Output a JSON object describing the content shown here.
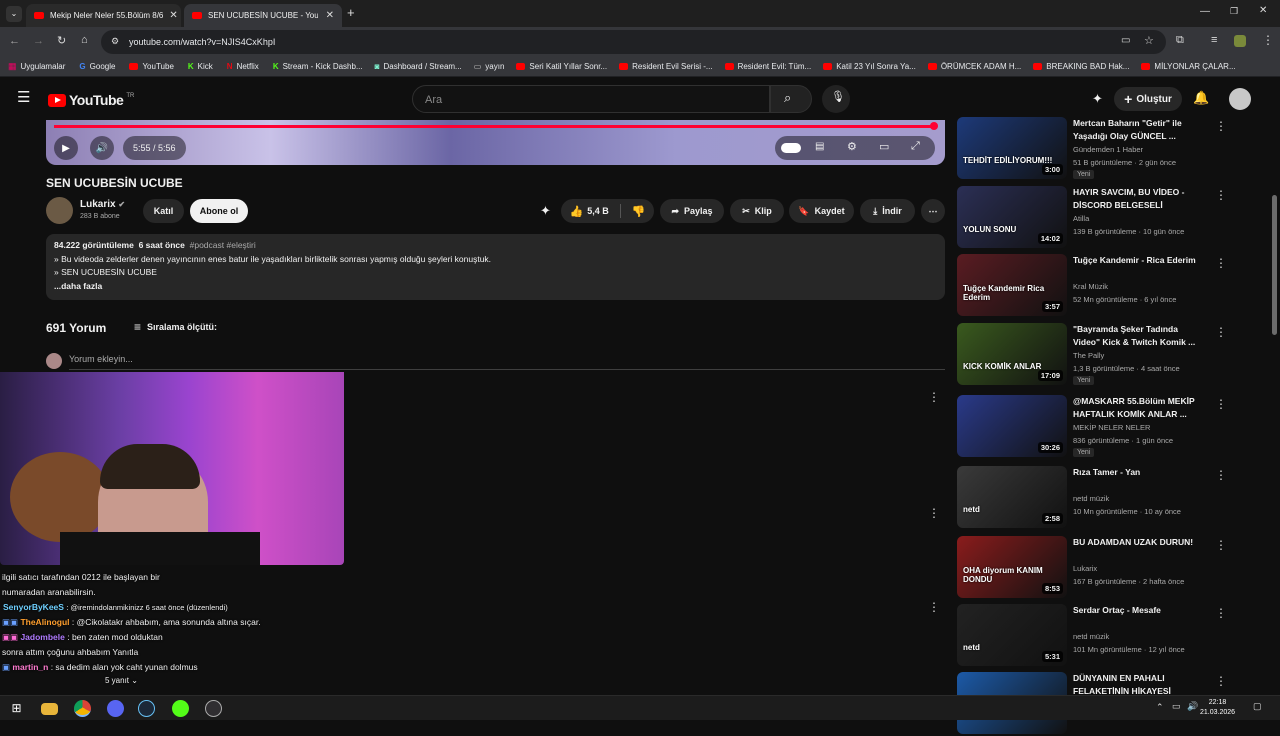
{
  "browser": {
    "tabs": [
      {
        "title": "Mekip Neler Neler 55.Bölüm 8/6"
      },
      {
        "title": "SEN UCUBESİN UCUBE - YouTube"
      }
    ],
    "url": "youtube.com/watch?v=NJIS4CxKhpI",
    "bookmarks": [
      "Uygulamalar",
      "Google",
      "YouTube",
      "Kick",
      "Netflix",
      "Stream - Kick Dashb...",
      "Dashboard / Stream...",
      "yayın",
      "Seri Katil Yıllar Sonr...",
      "Resident Evil Serisi -...",
      "Resident Evil: Tüm...",
      "Katil 23 Yıl Sonra Ya...",
      "ÖRÜMCEK ADAM H...",
      "BREAKING BAD Hak...",
      "MİLYONLAR ÇALAR..."
    ]
  },
  "header": {
    "logo": "YouTube",
    "logo_sup": "TR",
    "search_placeholder": "Ara",
    "create_label": "Oluştur"
  },
  "player": {
    "time": "5:55 / 5:56",
    "progress": 0.997
  },
  "video": {
    "title": "SEN UCUBESİN UCUBE",
    "channel": "Lukarix",
    "subscribers": "283 B abone",
    "join_label": "Katıl",
    "subscribe_label": "Abone ol",
    "likes": "5,4 B",
    "share_label": "Paylaş",
    "clip_label": "Klip",
    "save_label": "Kaydet",
    "download_label": "İndir"
  },
  "description": {
    "views": "84.222 görüntüleme",
    "age": "6 saat önce",
    "tags": "#podcast #eleştiri",
    "line1": "» Bu videoda zelderler denen yayıncının enes batur ile yaşadıkları birliktelik sonrası yapmış olduğu şeyleri konuştuk.",
    "line2": "» SEN UCUBESİN UCUBE",
    "more": "...daha fazla"
  },
  "comments": {
    "count": "691 Yorum",
    "sort_label": "Sıralama ölçütü:",
    "add_placeholder": "Yorum ekleyin..."
  },
  "chat": [
    {
      "user": "",
      "text": "ilgili satıcı tarafından 0212 ile başlayan bir"
    },
    {
      "user": "",
      "text": "numaradan aranabilirsin."
    },
    {
      "user": "SenyorByKeeS",
      "text": ": @iremindolanmikinizz 6 saat önce (düzenlendi)"
    },
    {
      "user": "TheAlinogul",
      "text": ": @Cikolatakr ahbabım, ama sonunda altına sıçar."
    },
    {
      "user": "Jadombele",
      "text": ": ben zaten mod olduktan"
    },
    {
      "user": "",
      "text": "sonra attım çoğunu ahbabım     Yanıtla"
    },
    {
      "user": "martin_n",
      "text": ": sa dedim alan yok caht yunan dolmus"
    },
    {
      "user": "",
      "text": "5 yanıt"
    }
  ],
  "sidebar": [
    {
      "title": "Mertcan Baharın \"Getir\" ile Yaşadığı Olay GÜNCEL ...",
      "channel": "Gündemden 1 Haber",
      "meta": "51 B görüntüleme · 2 gün önce",
      "duration": "3:00",
      "new": "Yeni",
      "thumb_text": "TEHDİT EDİLİYORUM!!!",
      "color": "#1d3a7a"
    },
    {
      "title": "HAYIR SAVCIM, BU VİDEO - DİSCORD BELGESELİ",
      "channel": "Atilla",
      "meta": "139 B görüntüleme · 10 gün önce",
      "duration": "14:02",
      "new": "",
      "thumb_text": "YOLUN SONU",
      "color": "#2b2f55"
    },
    {
      "title": "Tuğçe Kandemir - Rica Ederim",
      "channel": "Kral Müzik",
      "meta": "52 Mn görüntüleme · 6 yıl önce",
      "duration": "3:57",
      "new": "",
      "thumb_text": "Tuğçe Kandemir Rica Ederim",
      "color": "#5a1c22"
    },
    {
      "title": "\"Bayramda Şeker Tadında Video\" Kick & Twitch Komik ...",
      "channel": "The Pally",
      "meta": "1,3 B görüntüleme · 4 saat önce",
      "duration": "17:09",
      "new": "Yeni",
      "thumb_text": "KICK KOMİK ANLAR",
      "color": "#3a5a1e"
    },
    {
      "title": "@MASKARR 55.Bölüm MEKİP HAFTALIK KOMİK ANLAR ...",
      "channel": "MEKİP NELER NELER",
      "meta": "836 görüntüleme · 1 gün önce",
      "duration": "30:26",
      "new": "Yeni",
      "thumb_text": "",
      "color": "#2a3a8a"
    },
    {
      "title": "Rıza Tamer - Yan",
      "channel": "netd müzik",
      "meta": "10 Mn görüntüleme · 10 ay önce",
      "duration": "2:58",
      "new": "",
      "thumb_text": "netd",
      "color": "#3a3a3a"
    },
    {
      "title": "BU ADAMDAN UZAK DURUN!",
      "channel": "Lukarix",
      "meta": "167 B görüntüleme · 2 hafta önce",
      "duration": "8:53",
      "new": "",
      "thumb_text": "OHA diyorum KANIM DONDU",
      "color": "#8a1c1c"
    },
    {
      "title": "Serdar Ortaç - Mesafe",
      "channel": "netd müzik",
      "meta": "101 Mn görüntüleme · 12 yıl önce",
      "duration": "5:31",
      "new": "",
      "thumb_text": "netd",
      "color": "#222222"
    },
    {
      "title": "DÜNYANIN EN PAHALI FELAKETİNİN HİKAYESİ",
      "channel": "",
      "meta": "",
      "duration": "",
      "new": "",
      "thumb_text": "$45",
      "color": "#1c5aa8"
    }
  ],
  "taskbar": {
    "time": "22:18",
    "date": "21.03.2026"
  }
}
